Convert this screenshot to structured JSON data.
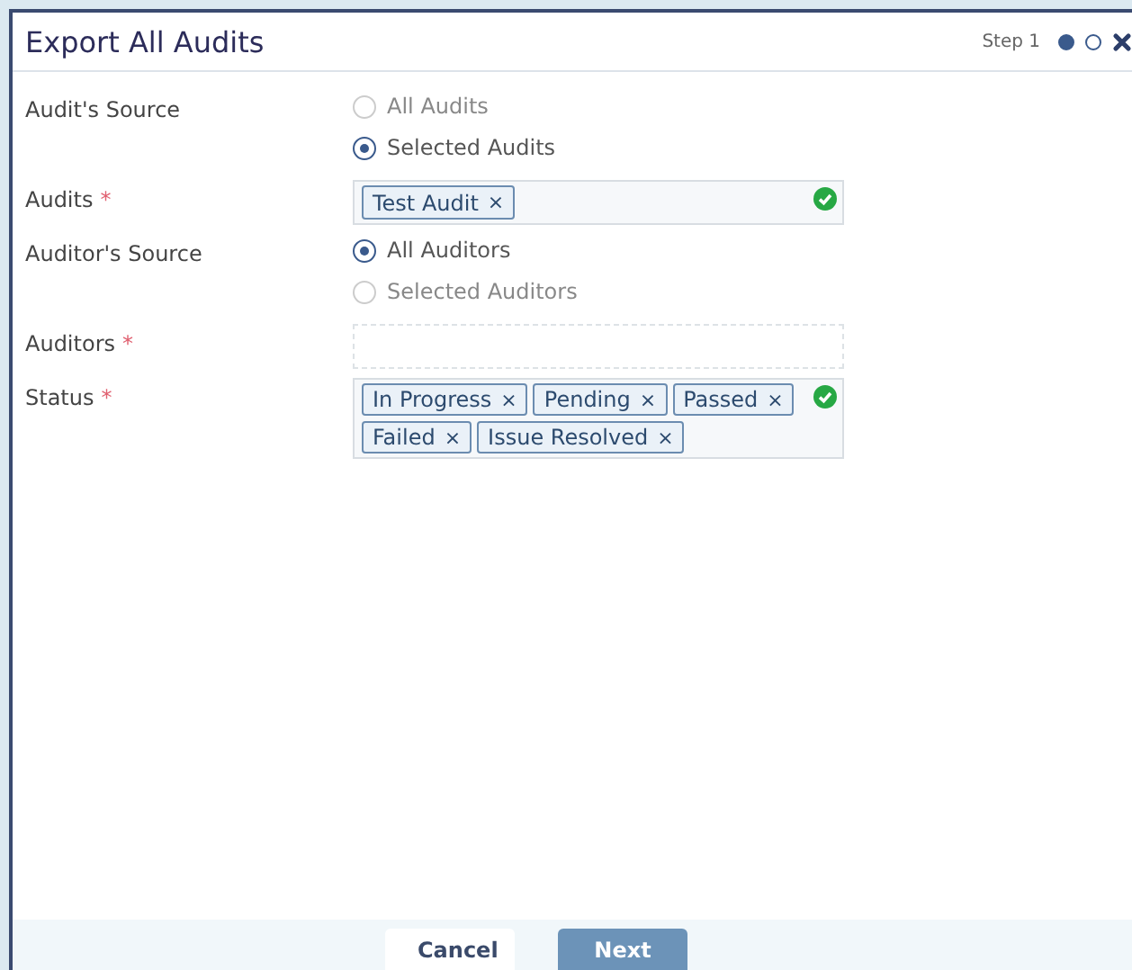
{
  "dialog": {
    "title": "Export All Audits",
    "step_label": "Step 1",
    "steps": [
      {
        "selected": true
      },
      {
        "selected": false
      }
    ]
  },
  "fields": [
    {
      "kind": "radio",
      "label": "Audit's Source",
      "options": [
        {
          "label": "All Audits",
          "selected": false
        },
        {
          "label": "Selected Audits",
          "selected": true
        }
      ]
    },
    {
      "kind": "tags",
      "label": "Audits",
      "required_mark": "*",
      "valid": true,
      "tags": [
        {
          "label": "Test Audit",
          "remove": "×"
        }
      ]
    },
    {
      "kind": "radio",
      "label": "Auditor's Source",
      "options": [
        {
          "label": "All Auditors",
          "selected": true
        },
        {
          "label": "Selected Auditors",
          "selected": false
        }
      ]
    },
    {
      "kind": "tags",
      "label": "Auditors",
      "required_mark": "*",
      "valid": false
    },
    {
      "kind": "tags",
      "label": "Status",
      "required_mark": "*",
      "valid": true,
      "tags": [
        {
          "label": "In Progress",
          "remove": "×"
        },
        {
          "label": "Pending",
          "remove": "×"
        },
        {
          "label": "Passed",
          "remove": "×"
        },
        {
          "label": "Failed",
          "remove": "×"
        },
        {
          "label": "Issue Resolved",
          "remove": "×"
        }
      ]
    }
  ],
  "footer": {
    "buttons": [
      {
        "label": "Cancel",
        "kind": "secondary"
      },
      {
        "label": "Next",
        "kind": "primary"
      }
    ]
  }
}
